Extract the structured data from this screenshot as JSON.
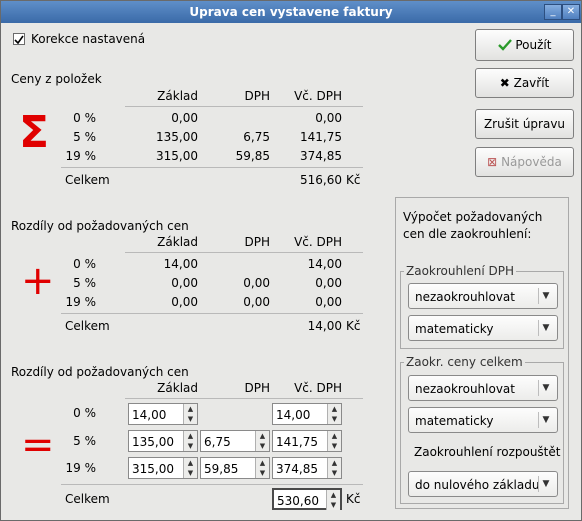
{
  "window": {
    "title": "Uprava cen vystavene faktury"
  },
  "checkbox": {
    "label": "Korekce nastavená",
    "checked": true
  },
  "buttons": {
    "use": "Použít",
    "close": "Zavřít",
    "cancel": "Zrušit úpravu",
    "help": "Nápověda"
  },
  "section1": {
    "title": "Ceny z položek",
    "headers": {
      "zaklad": "Základ",
      "dph": "DPH",
      "vc_dph": "Vč. DPH"
    },
    "rows": [
      {
        "rate": "0 %",
        "zaklad": "0,00",
        "dph": "",
        "vc_dph": "0,00"
      },
      {
        "rate": "5 %",
        "zaklad": "135,00",
        "dph": "6,75",
        "vc_dph": "141,75"
      },
      {
        "rate": "19 %",
        "zaklad": "315,00",
        "dph": "59,85",
        "vc_dph": "374,85"
      }
    ],
    "total_label": "Celkem",
    "total": "516,60",
    "currency": "Kč"
  },
  "section2": {
    "title": "Rozdíly od požadovaných cen",
    "headers": {
      "zaklad": "Základ",
      "dph": "DPH",
      "vc_dph": "Vč. DPH"
    },
    "rows": [
      {
        "rate": "0 %",
        "zaklad": "14,00",
        "dph": "",
        "vc_dph": "14,00"
      },
      {
        "rate": "5 %",
        "zaklad": "0,00",
        "dph": "0,00",
        "vc_dph": "0,00"
      },
      {
        "rate": "19 %",
        "zaklad": "0,00",
        "dph": "0,00",
        "vc_dph": "0,00"
      }
    ],
    "total_label": "Celkem",
    "total": "14,00",
    "currency": "Kč"
  },
  "section3": {
    "title": "Rozdíly od požadovaných cen",
    "headers": {
      "zaklad": "Základ",
      "dph": "DPH",
      "vc_dph": "Vč. DPH"
    },
    "rows": [
      {
        "rate": "0 %",
        "zaklad": "14,00",
        "vc_dph": "14,00"
      },
      {
        "rate": "5 %",
        "zaklad": "135,00",
        "dph": "6,75",
        "vc_dph": "141,75"
      },
      {
        "rate": "19 %",
        "zaklad": "315,00",
        "dph": "59,85",
        "vc_dph": "374,85"
      }
    ],
    "total_label": "Celkem",
    "total": "530,60",
    "currency": "Kč"
  },
  "side": {
    "intro": "Výpočet požadovaných cen dle zaokrouhlení:",
    "group1": {
      "title": "Zaokrouhlení DPH",
      "combo1": "nezaokrouhlovat",
      "combo2": "matematicky"
    },
    "group2": {
      "title": "Zaokr. ceny celkem",
      "combo1": "nezaokrouhlovat",
      "combo2": "matematicky",
      "spread_label": "Zaokrouhlení rozpouštět",
      "combo3": "do nulového základu"
    }
  },
  "icons": {
    "sum": "Σ",
    "plus": "+",
    "equals": "="
  },
  "colors": {
    "accent_red": "#e00000",
    "titlebar": "#4a7bbb",
    "check_green": "#2a9a2a"
  }
}
